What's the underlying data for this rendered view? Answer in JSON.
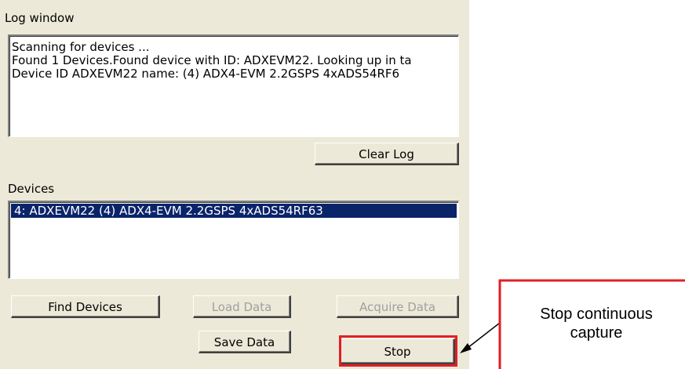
{
  "log_window": {
    "label": "Log window",
    "lines": [
      "Scanning for devices ...",
      "Found 1 Devices.Found device with ID: ADXEVM22. Looking up in ta",
      "Device ID ADXEVM22 name: (4) ADX4-EVM 2.2GSPS 4xADS54RF6"
    ],
    "clear_button": "Clear Log"
  },
  "devices": {
    "label": "Devices",
    "items": [
      "4: ADXEVM22 (4) ADX4-EVM 2.2GSPS 4xADS54RF63"
    ],
    "selected_index": 0
  },
  "buttons": {
    "find": "Find Devices",
    "load": "Load Data",
    "acquire": "Acquire Data",
    "save": "Save Data",
    "stop": "Stop"
  },
  "callout": {
    "text": "Stop continuous capture",
    "color": "#e31e24"
  }
}
